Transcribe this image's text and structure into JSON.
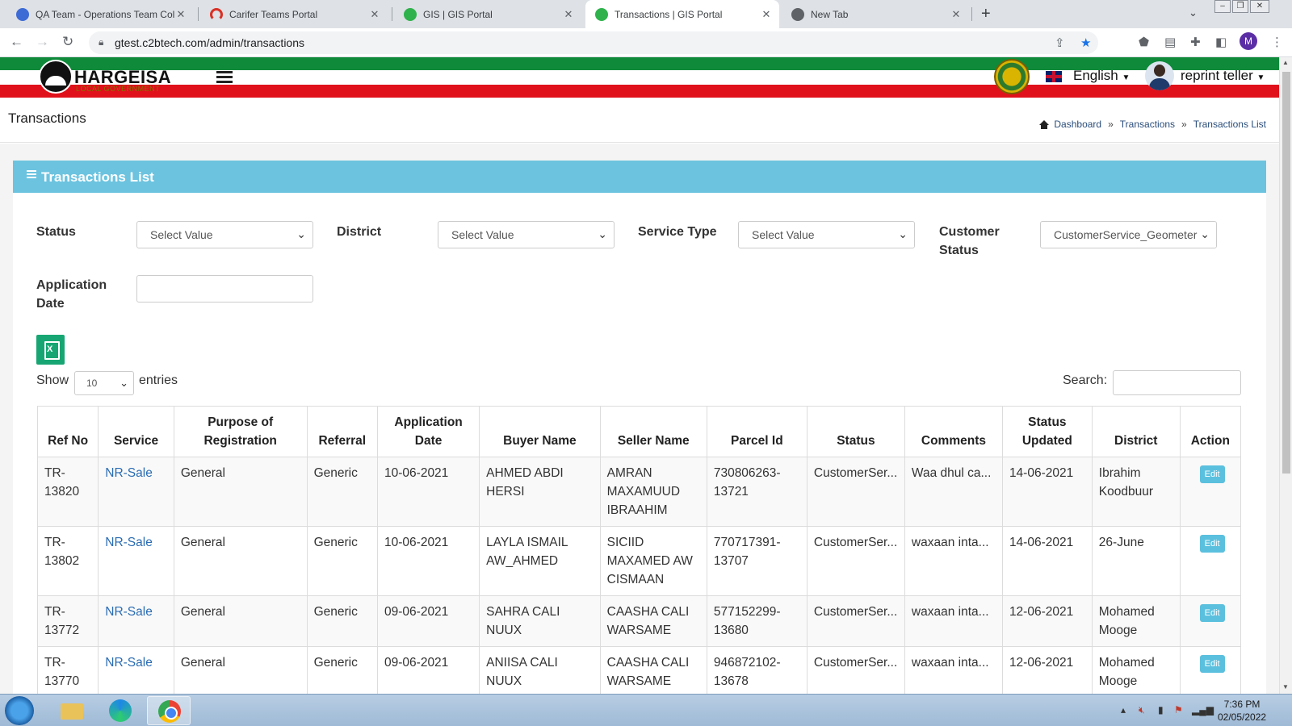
{
  "browser": {
    "tabs": [
      {
        "title": "QA Team - Operations Team Coll",
        "active": false
      },
      {
        "title": "Carifer Teams Portal",
        "active": false
      },
      {
        "title": "GIS | GIS Portal",
        "active": false
      },
      {
        "title": "Transactions | GIS Portal",
        "active": true
      },
      {
        "title": "New Tab",
        "active": false
      }
    ],
    "url": "gtest.c2btech.com/admin/transactions",
    "profile_initial": "M"
  },
  "site": {
    "logo_text": "HARGEISA",
    "logo_subtext": "LOCAL GOVERNMENT",
    "language": "English",
    "username": "reprint teller"
  },
  "page": {
    "title": "Transactions",
    "breadcrumbs": [
      "Dashboard",
      "Transactions",
      "Transactions List"
    ],
    "breadcrumb_sep": "»"
  },
  "card": {
    "title": "Transactions List"
  },
  "filters": {
    "status_label": "Status",
    "status_value": "Select Value",
    "district_label": "District",
    "district_value": "Select Value",
    "service_type_label": "Service Type",
    "service_type_value": "Select Value",
    "customer_status_label_1": "Customer",
    "customer_status_label_2": "Status",
    "customer_status_value": "CustomerService_Geometer",
    "application_date_label_1": "Application",
    "application_date_label_2": "Date",
    "application_date_value": ""
  },
  "table_controls": {
    "show_label": "Show",
    "page_length": "10",
    "entries_label": "entries",
    "search_label": "Search:",
    "search_value": ""
  },
  "table": {
    "headers": [
      "Ref No",
      "Service",
      "Purpose of Registration",
      "Referral",
      "Application Date",
      "Buyer Name",
      "Seller Name",
      "Parcel Id",
      "Status",
      "Comments",
      "Status Updated",
      "District",
      "Action"
    ],
    "rows": [
      {
        "ref_no": "TR-13820",
        "service": "NR-Sale",
        "purpose": "General",
        "referral": "Generic",
        "app_date": "10-06-2021",
        "buyer": "AHMED ABDI HERSI",
        "seller": "AMRAN MAXAMUUD IBRAAHIM",
        "parcel_id": "730806263-13721",
        "status": "CustomerSer...",
        "comments": "Waa dhul ca...",
        "status_updated": "14-06-2021",
        "district": "Ibrahim Koodbuur",
        "action": "Edit"
      },
      {
        "ref_no": "TR-13802",
        "service": "NR-Sale",
        "purpose": "General",
        "referral": "Generic",
        "app_date": "10-06-2021",
        "buyer": "LAYLA ISMAIL AW_AHMED",
        "seller": "SICIID MAXAMED AW CISMAAN",
        "parcel_id": "770717391-13707",
        "status": "CustomerSer...",
        "comments": "waxaan inta...",
        "status_updated": "14-06-2021",
        "district": "26-June",
        "action": "Edit"
      },
      {
        "ref_no": "TR-13772",
        "service": "NR-Sale",
        "purpose": "General",
        "referral": "Generic",
        "app_date": "09-06-2021",
        "buyer": "SAHRA CALI NUUX",
        "seller": "CAASHA CALI WARSAME",
        "parcel_id": "577152299-13680",
        "status": "CustomerSer...",
        "comments": "waxaan inta...",
        "status_updated": "12-06-2021",
        "district": "Mohamed Mooge",
        "action": "Edit"
      },
      {
        "ref_no": "TR-13770",
        "service": "NR-Sale",
        "purpose": "General",
        "referral": "Generic",
        "app_date": "09-06-2021",
        "buyer": "ANIISA CALI NUUX",
        "seller": "CAASHA CALI WARSAME",
        "parcel_id": "946872102-13678",
        "status": "CustomerSer...",
        "comments": "waxaan inta...",
        "status_updated": "12-06-2021",
        "district": "Mohamed Mooge",
        "action": "Edit"
      }
    ]
  },
  "taskbar": {
    "time": "7:36 PM",
    "date": "02/05/2022"
  },
  "colors": {
    "accent_header": "#6cc3df",
    "band_green": "#0e8a3a",
    "band_red": "#e0111b",
    "edit_button": "#5bc0de",
    "link": "#2a6cb3"
  }
}
